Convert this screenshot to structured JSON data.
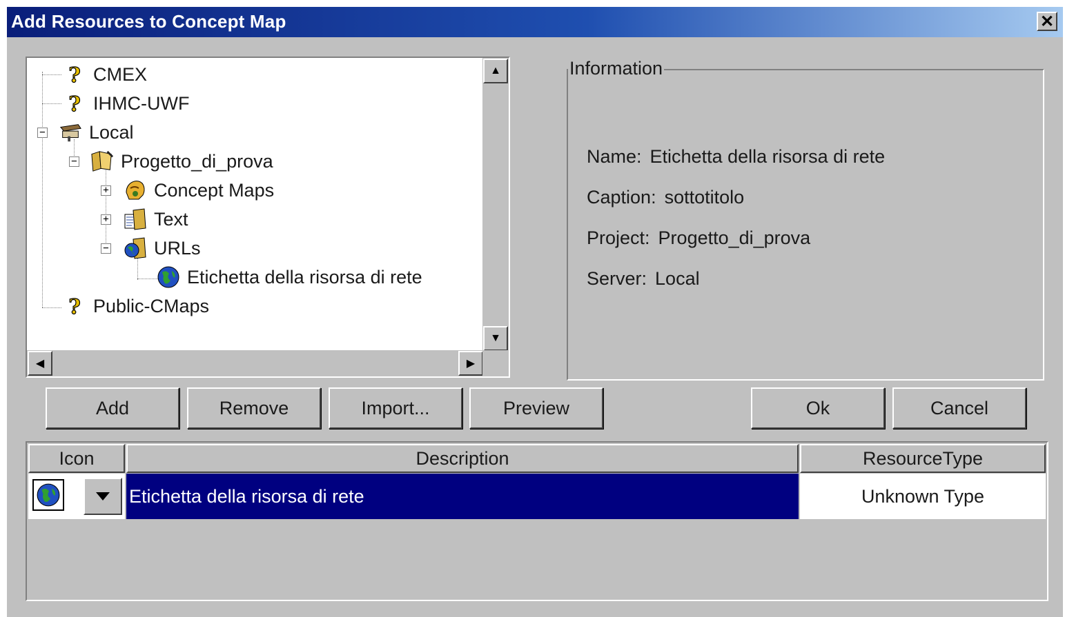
{
  "window": {
    "title": "Add Resources to Concept Map",
    "close_glyph": "✕"
  },
  "tree": {
    "nodes": [
      {
        "label": "CMEX",
        "icon": "question-icon"
      },
      {
        "label": "IHMC-UWF",
        "icon": "question-icon"
      },
      {
        "label": "Local",
        "icon": "server-icon",
        "expander": "−"
      },
      {
        "label": "Progetto_di_prova",
        "icon": "folder-icon",
        "expander": "−"
      },
      {
        "label": "Concept Maps",
        "icon": "concept-maps-icon",
        "expander": "+"
      },
      {
        "label": "Text",
        "icon": "text-folder-icon",
        "expander": "+"
      },
      {
        "label": "URLs",
        "icon": "urls-folder-icon",
        "expander": "−"
      },
      {
        "label": "Etichetta della risorsa di rete",
        "icon": "globe-icon"
      },
      {
        "label": "Public-CMaps",
        "icon": "question-icon"
      }
    ]
  },
  "info": {
    "legend": "Information",
    "name_label": "Name:",
    "name_value": "Etichetta della risorsa di rete",
    "caption_label": "Caption:",
    "caption_value": "sottotitolo",
    "project_label": "Project:",
    "project_value": "Progetto_di_prova",
    "server_label": "Server:",
    "server_value": "Local"
  },
  "buttons": {
    "add": "Add",
    "remove": "Remove",
    "import": "Import...",
    "preview": "Preview",
    "ok": "Ok",
    "cancel": "Cancel"
  },
  "table": {
    "headers": {
      "icon": "Icon",
      "description": "Description",
      "resource_type": "ResourceType"
    },
    "rows": [
      {
        "icon": "globe-icon",
        "description": "Etichetta della risorsa di rete",
        "resource_type": "Unknown Type",
        "selected": true
      }
    ]
  },
  "colors": {
    "title_start": "#0a1e7a",
    "title_end": "#a6caf0",
    "selection": "#000080",
    "face": "#c0c0c0"
  }
}
